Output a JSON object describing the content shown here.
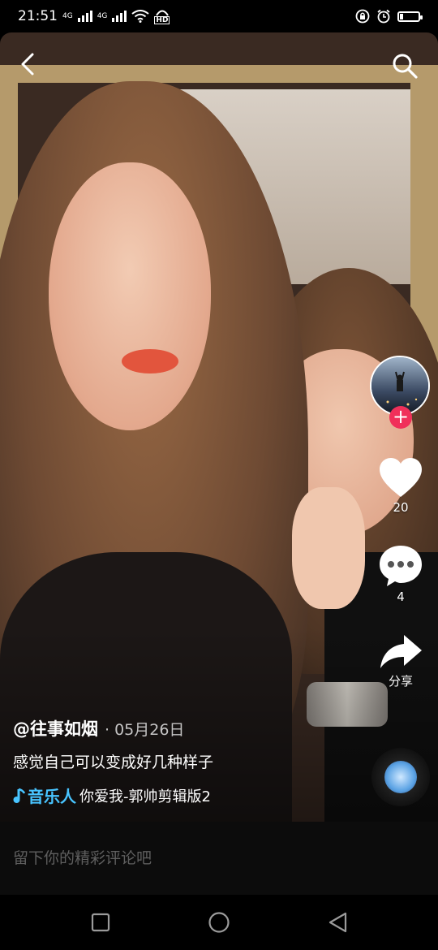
{
  "status_bar": {
    "time": "21:51",
    "network_labels": [
      "4G",
      "4G"
    ],
    "hd_label": "HD",
    "battery_level": 0.2,
    "icons": [
      "signal-icon",
      "signal-icon",
      "wifi-icon",
      "hd-voice-icon",
      "alarm-lock-icon",
      "alarm-clock-icon",
      "battery-icon"
    ]
  },
  "video": {
    "icons": {
      "back": "back-arrow-icon",
      "search": "search-icon"
    },
    "right_rail": {
      "avatar_icon": "author-avatar",
      "follow_symbol": "+",
      "like_count": "20",
      "comment_count": "4",
      "share_label": "分享"
    },
    "caption": {
      "author": "@往事如烟",
      "date": "· 05月26日",
      "description": "感觉自己可以变成好几种样子",
      "music_tag": "音乐人",
      "music_title": "你爱我-郭帅剪辑版2"
    }
  },
  "comment_bar": {
    "placeholder": "留下你的精彩评论吧"
  },
  "nav_bar": {
    "buttons": [
      "recents-square-icon",
      "home-circle-icon",
      "back-triangle-icon"
    ]
  },
  "colors": {
    "accent_red": "#f0305a",
    "music_blue": "#48c4ff",
    "background": "#000000"
  }
}
